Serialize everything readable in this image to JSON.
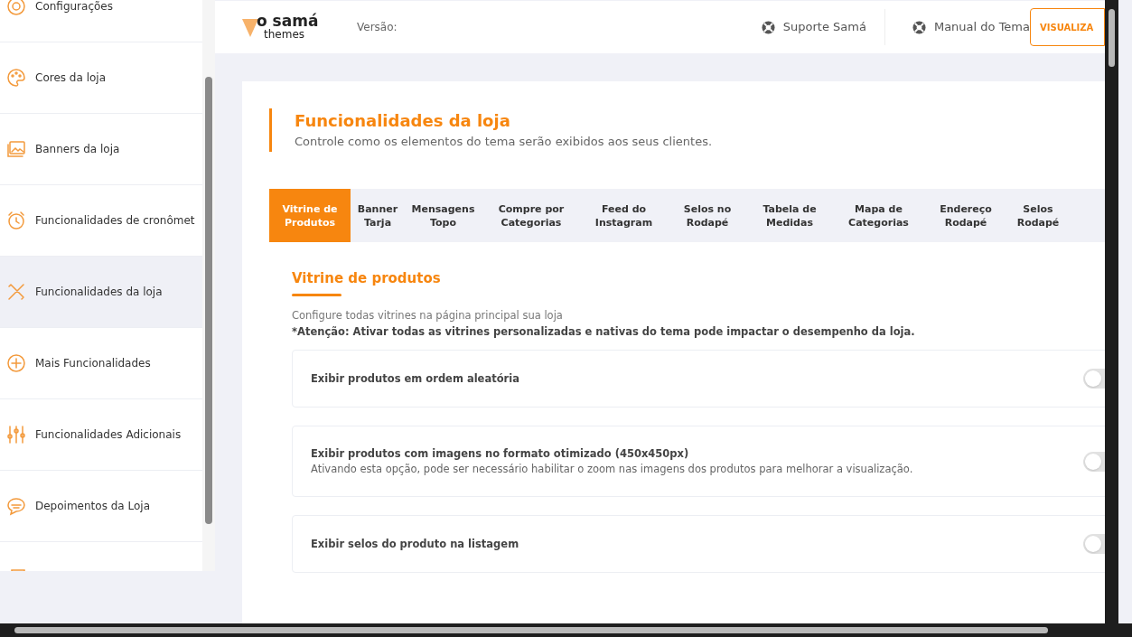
{
  "sidebar": {
    "items": [
      {
        "label": "Configurações",
        "selected": false
      },
      {
        "label": "Cores da loja",
        "selected": false
      },
      {
        "label": "Banners da loja",
        "selected": false
      },
      {
        "label": "Funcionalidades de cronômet",
        "selected": false
      },
      {
        "label": "Funcionalidades da loja",
        "selected": true
      },
      {
        "label": "Mais Funcionalidades",
        "selected": false
      },
      {
        "label": "Funcionalidades Adicionais",
        "selected": false
      },
      {
        "label": "Depoimentos da Loja",
        "selected": false
      },
      {
        "selected": false
      }
    ]
  },
  "header": {
    "logo_top": "o samá",
    "logo_bottom": "themes",
    "version_label": "Versão:",
    "links": [
      "Suporte Samá",
      "Manual do Tema"
    ],
    "button": "VISUALIZA"
  },
  "page": {
    "title": "Funcionalidades da loja",
    "subtitle": "Controle como os elementos do tema serão exibidos aos seus clientes."
  },
  "tabs": [
    {
      "label": "Vitrine de Produtos",
      "selected": true
    },
    {
      "label": "Banner Tarja",
      "selected": false
    },
    {
      "label": "Mensagens Topo",
      "selected": false
    },
    {
      "label": "Compre por Categorias",
      "selected": false
    },
    {
      "label": "Feed do Instagram",
      "selected": false
    },
    {
      "label": "Selos no Rodapé",
      "selected": false
    },
    {
      "label": "Tabela de Medidas",
      "selected": false
    },
    {
      "label": "Mapa de Categorias",
      "selected": false
    },
    {
      "label": "Endereço Rodapé",
      "selected": false
    },
    {
      "label": "Selos Rodapé",
      "selected": false
    }
  ],
  "section": {
    "title": "Vitrine de produtos",
    "description": "Configure todas vitrines na página principal sua loja",
    "warning": "*Atenção: Ativar todas as vitrines personalizadas e nativas do tema pode impactar o desempenho da loja.",
    "options": [
      {
        "label": "Exibir produtos em ordem aleatória",
        "on": false
      },
      {
        "label": "Exibir produtos com imagens no formato otimizado (450x450px)",
        "hint": "Ativando esta opção, pode ser necessário habilitar o zoom nas imagens dos produtos para melhorar a visualização.",
        "on": false
      },
      {
        "label": "Exibir selos do produto na listagem",
        "on": false
      }
    ]
  }
}
